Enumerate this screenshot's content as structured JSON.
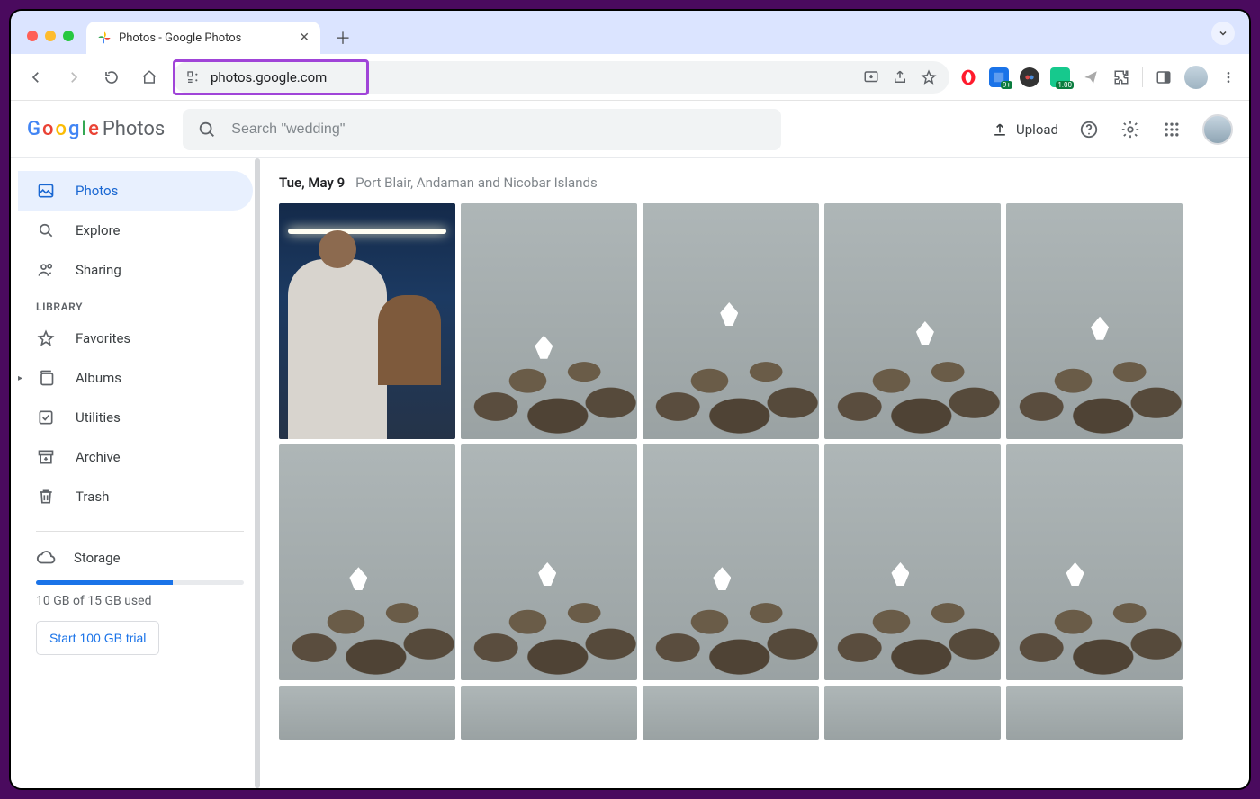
{
  "browser": {
    "tab_title": "Photos - Google Photos",
    "url": "photos.google.com",
    "extensions": {
      "opera_badge": "9+",
      "grammarly_badge": "1.00"
    }
  },
  "app": {
    "logo_suffix": "Photos",
    "search_placeholder": "Search \"wedding\"",
    "upload_label": "Upload"
  },
  "sidebar": {
    "photos": "Photos",
    "explore": "Explore",
    "sharing": "Sharing",
    "section_library": "LIBRARY",
    "favorites": "Favorites",
    "albums": "Albums",
    "utilities": "Utilities",
    "archive": "Archive",
    "trash": "Trash",
    "storage": "Storage",
    "storage_used_label": "10 GB of 15 GB used",
    "storage_percent": 66,
    "trial_button": "Start 100 GB trial"
  },
  "content": {
    "date": "Tue, May 9",
    "location": "Port Blair, Andaman and Nicobar Islands"
  }
}
